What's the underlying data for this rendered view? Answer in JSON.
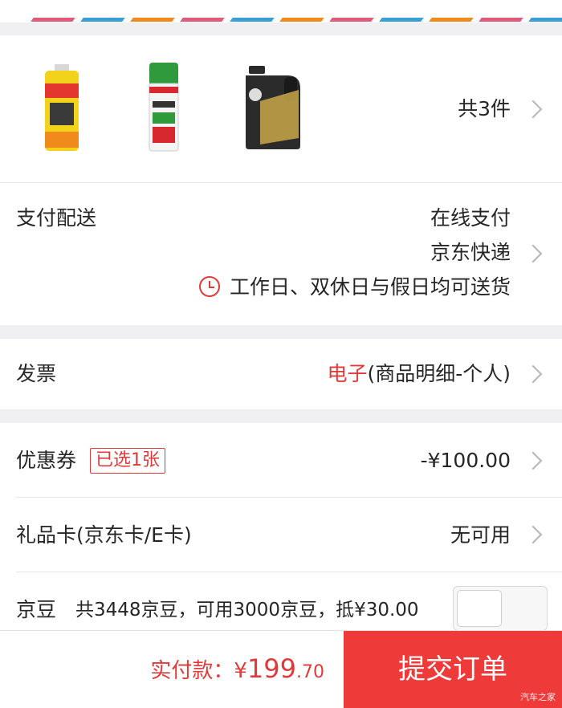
{
  "colors": {
    "accent": "#e03b3b",
    "submit_bg": "#ef3a3a"
  },
  "products": {
    "count_label": "共3件",
    "items": [
      {
        "icon": "spray-can-yellow-icon"
      },
      {
        "icon": "spray-can-green-icon"
      },
      {
        "icon": "engine-oil-jug-icon"
      }
    ]
  },
  "delivery": {
    "label": "支付配送",
    "payment": "在线支付",
    "courier": "京东快递",
    "schedule": "工作日、双休日与假日均可送货"
  },
  "invoice": {
    "label": "发票",
    "type": "电子",
    "detail": "(商品明细-个人)"
  },
  "coupon": {
    "label": "优惠券",
    "badge": "已选1张",
    "value": "-¥100.00"
  },
  "gift_card": {
    "label": "礼品卡(京东卡/E卡)",
    "value": "无可用"
  },
  "jingdou": {
    "label": "京豆",
    "info": "共3448京豆，可用3000京豆，抵¥30.00",
    "toggle_on": false
  },
  "footer": {
    "pay_label": "实付款：",
    "currency": "¥",
    "amount_int": "199",
    "amount_dec": ".70",
    "submit": "提交订单",
    "watermark": "汽车之家"
  }
}
